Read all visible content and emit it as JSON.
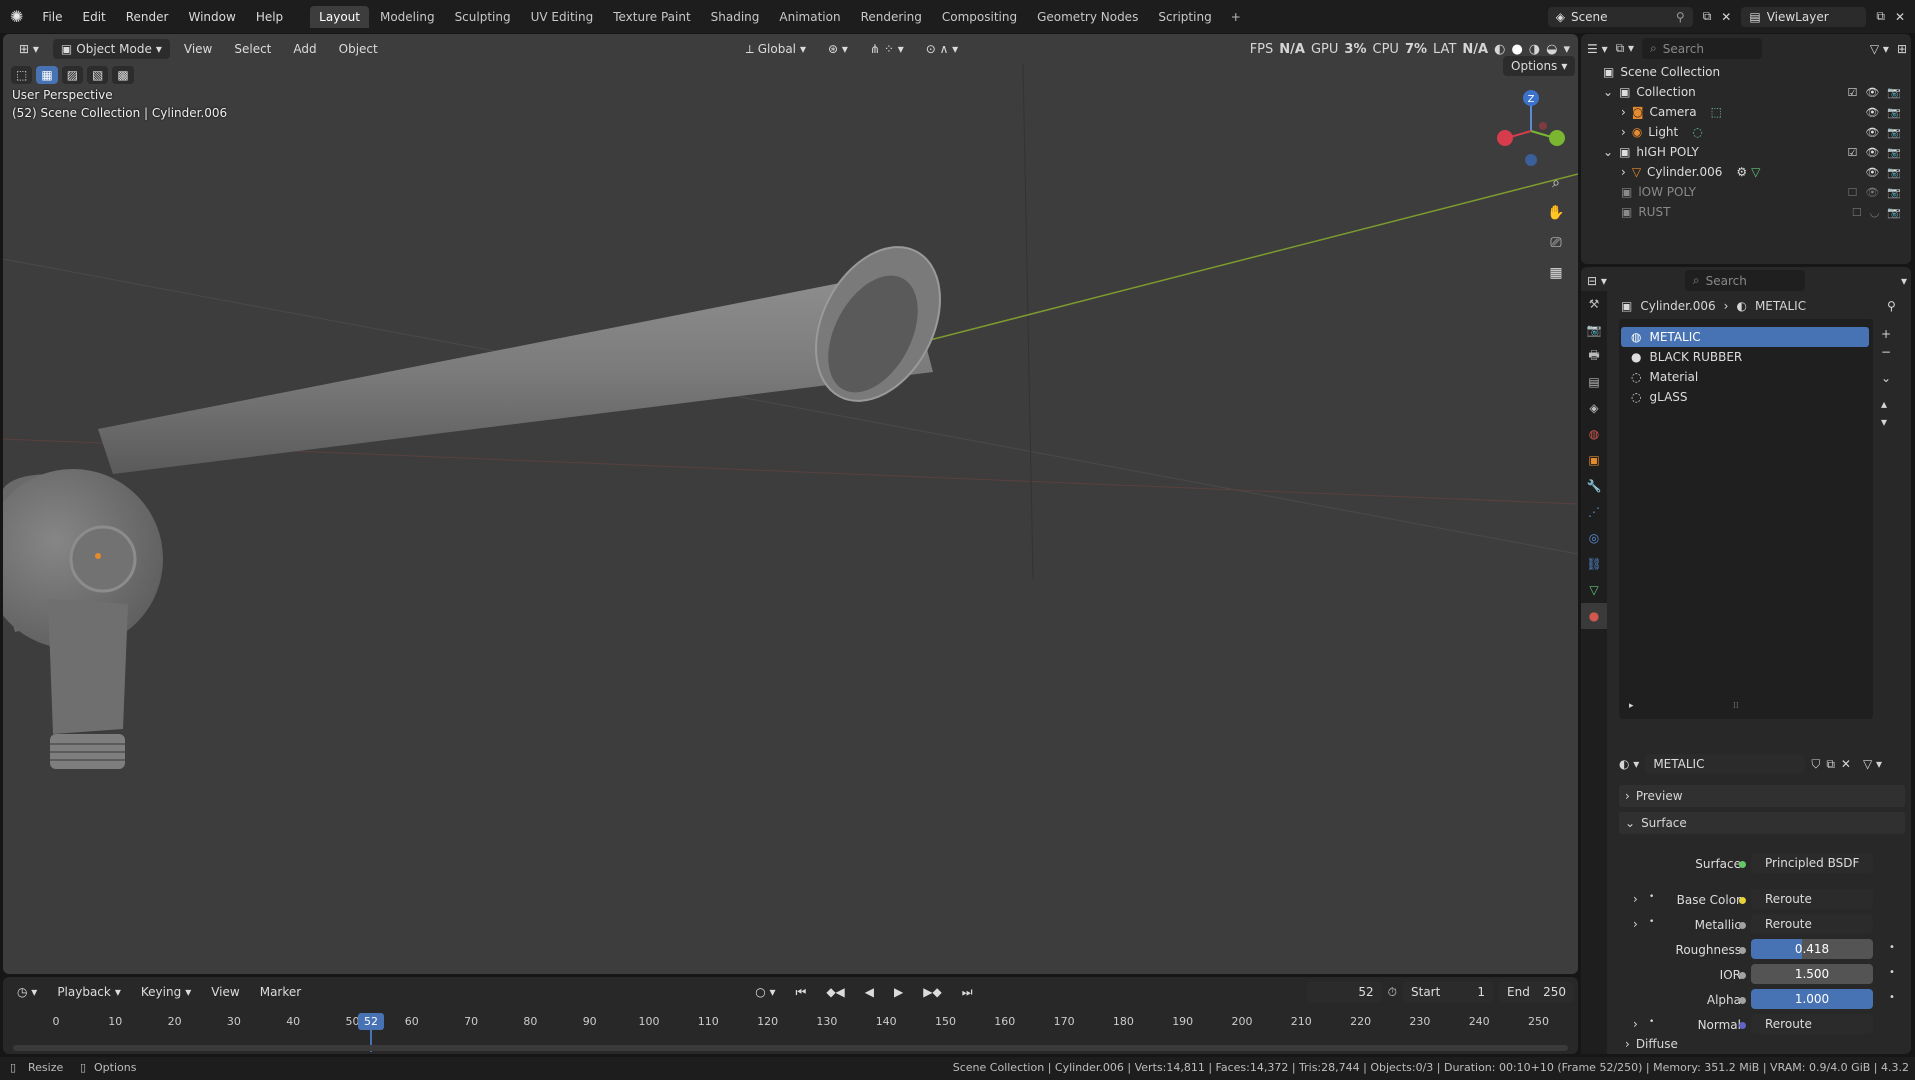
{
  "app": {
    "menus": [
      "File",
      "Edit",
      "Render",
      "Window",
      "Help"
    ],
    "workspace_tabs": [
      "Layout",
      "Modeling",
      "Sculpting",
      "UV Editing",
      "Texture Paint",
      "Shading",
      "Animation",
      "Rendering",
      "Compositing",
      "Geometry Nodes",
      "Scripting"
    ],
    "active_tab": "Layout",
    "scene_name": "Scene",
    "view_layer": "ViewLayer"
  },
  "viewport": {
    "mode": "Object Mode",
    "menus": [
      "View",
      "Select",
      "Add",
      "Object"
    ],
    "orientation": "Global",
    "options_label": "Options",
    "perspective_label": "User Perspective",
    "context_label": "(52) Scene Collection | Cylinder.006",
    "stats": {
      "fps_label": "FPS",
      "fps": "N/A",
      "gpu_label": "GPU",
      "gpu": "3%",
      "cpu_label": "CPU",
      "cpu": "7%",
      "lat_label": "LAT",
      "lat": "N/A"
    },
    "gizmo": {
      "z": "Z"
    }
  },
  "outliner": {
    "search_placeholder": "Search",
    "root": "Scene Collection",
    "items": [
      {
        "name": "Collection",
        "type": "collection"
      },
      {
        "name": "Camera",
        "type": "camera"
      },
      {
        "name": "Light",
        "type": "light"
      },
      {
        "name": "hIGH POLY",
        "type": "collection"
      },
      {
        "name": "Cylinder.006",
        "type": "mesh"
      },
      {
        "name": "lOW POLY",
        "type": "collection-disabled"
      },
      {
        "name": "RUST",
        "type": "collection-disabled"
      }
    ]
  },
  "properties": {
    "search_placeholder": "Search",
    "breadcrumb_object": "Cylinder.006",
    "breadcrumb_material": "METALIC",
    "materials": [
      "METALIC",
      "BLACK RUBBER",
      "Material",
      "gLASS"
    ],
    "selected_material": "METALIC",
    "material_name": "METALIC",
    "sections": {
      "preview": "Preview",
      "surface": "Surface",
      "diffuse": "Diffuse"
    },
    "surface_label": "Surface",
    "surface_value": "Principled BSDF",
    "rows": [
      {
        "label": "Base Color",
        "value": "Reroute",
        "kind": "link"
      },
      {
        "label": "Metallic",
        "value": "Reroute",
        "kind": "link"
      },
      {
        "label": "Roughness",
        "value": "0.418",
        "kind": "number",
        "fill": 0.418
      },
      {
        "label": "IOR",
        "value": "1.500",
        "kind": "number",
        "fill": 0
      },
      {
        "label": "Alpha",
        "value": "1.000",
        "kind": "number",
        "fill": 1.0
      },
      {
        "label": "Normal",
        "value": "Reroute",
        "kind": "link"
      }
    ],
    "colors": {
      "reroute_yellow": "#e6d23a",
      "socket_gray": "#a1a1a1",
      "socket_purple": "#6363c7",
      "surface_green": "#63c763"
    }
  },
  "timeline": {
    "menus": [
      "Playback",
      "Keying",
      "View",
      "Marker"
    ],
    "current_frame": "52",
    "start_label": "Start",
    "start": "1",
    "end_label": "End",
    "end": "250",
    "ticks": [
      "0",
      "10",
      "20",
      "30",
      "40",
      "50",
      "60",
      "70",
      "80",
      "90",
      "100",
      "110",
      "120",
      "130",
      "140",
      "150",
      "160",
      "170",
      "180",
      "190",
      "200",
      "210",
      "220",
      "230",
      "240",
      "250"
    ]
  },
  "statusbar": {
    "left1": "Resize",
    "left2": "Options",
    "info": "Scene Collection | Cylinder.006 | Verts:14,811 | Faces:14,372 | Tris:28,744 | Objects:0/3 | Duration: 00:10+10 (Frame 52/250) | Memory: 351.2 MiB | VRAM: 0.9/4.0 GiB | 4.3.2"
  }
}
